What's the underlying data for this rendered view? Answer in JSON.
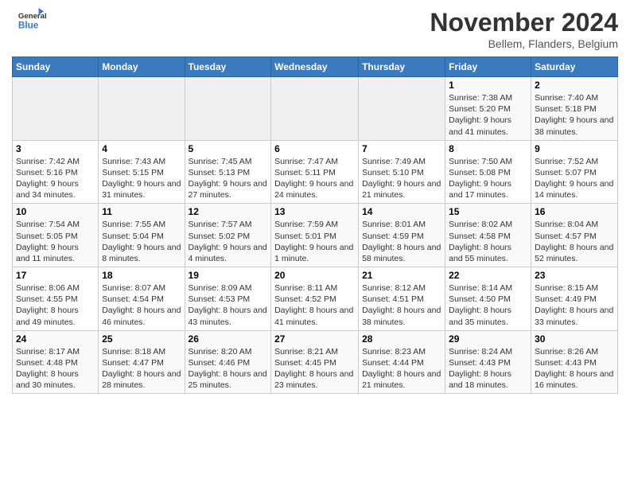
{
  "header": {
    "logo_line1": "General",
    "logo_line2": "Blue",
    "month": "November 2024",
    "location": "Bellem, Flanders, Belgium"
  },
  "weekdays": [
    "Sunday",
    "Monday",
    "Tuesday",
    "Wednesday",
    "Thursday",
    "Friday",
    "Saturday"
  ],
  "weeks": [
    [
      {
        "day": "",
        "info": ""
      },
      {
        "day": "",
        "info": ""
      },
      {
        "day": "",
        "info": ""
      },
      {
        "day": "",
        "info": ""
      },
      {
        "day": "",
        "info": ""
      },
      {
        "day": "1",
        "info": "Sunrise: 7:38 AM\nSunset: 5:20 PM\nDaylight: 9 hours and 41 minutes."
      },
      {
        "day": "2",
        "info": "Sunrise: 7:40 AM\nSunset: 5:18 PM\nDaylight: 9 hours and 38 minutes."
      }
    ],
    [
      {
        "day": "3",
        "info": "Sunrise: 7:42 AM\nSunset: 5:16 PM\nDaylight: 9 hours and 34 minutes."
      },
      {
        "day": "4",
        "info": "Sunrise: 7:43 AM\nSunset: 5:15 PM\nDaylight: 9 hours and 31 minutes."
      },
      {
        "day": "5",
        "info": "Sunrise: 7:45 AM\nSunset: 5:13 PM\nDaylight: 9 hours and 27 minutes."
      },
      {
        "day": "6",
        "info": "Sunrise: 7:47 AM\nSunset: 5:11 PM\nDaylight: 9 hours and 24 minutes."
      },
      {
        "day": "7",
        "info": "Sunrise: 7:49 AM\nSunset: 5:10 PM\nDaylight: 9 hours and 21 minutes."
      },
      {
        "day": "8",
        "info": "Sunrise: 7:50 AM\nSunset: 5:08 PM\nDaylight: 9 hours and 17 minutes."
      },
      {
        "day": "9",
        "info": "Sunrise: 7:52 AM\nSunset: 5:07 PM\nDaylight: 9 hours and 14 minutes."
      }
    ],
    [
      {
        "day": "10",
        "info": "Sunrise: 7:54 AM\nSunset: 5:05 PM\nDaylight: 9 hours and 11 minutes."
      },
      {
        "day": "11",
        "info": "Sunrise: 7:55 AM\nSunset: 5:04 PM\nDaylight: 9 hours and 8 minutes."
      },
      {
        "day": "12",
        "info": "Sunrise: 7:57 AM\nSunset: 5:02 PM\nDaylight: 9 hours and 4 minutes."
      },
      {
        "day": "13",
        "info": "Sunrise: 7:59 AM\nSunset: 5:01 PM\nDaylight: 9 hours and 1 minute."
      },
      {
        "day": "14",
        "info": "Sunrise: 8:01 AM\nSunset: 4:59 PM\nDaylight: 8 hours and 58 minutes."
      },
      {
        "day": "15",
        "info": "Sunrise: 8:02 AM\nSunset: 4:58 PM\nDaylight: 8 hours and 55 minutes."
      },
      {
        "day": "16",
        "info": "Sunrise: 8:04 AM\nSunset: 4:57 PM\nDaylight: 8 hours and 52 minutes."
      }
    ],
    [
      {
        "day": "17",
        "info": "Sunrise: 8:06 AM\nSunset: 4:55 PM\nDaylight: 8 hours and 49 minutes."
      },
      {
        "day": "18",
        "info": "Sunrise: 8:07 AM\nSunset: 4:54 PM\nDaylight: 8 hours and 46 minutes."
      },
      {
        "day": "19",
        "info": "Sunrise: 8:09 AM\nSunset: 4:53 PM\nDaylight: 8 hours and 43 minutes."
      },
      {
        "day": "20",
        "info": "Sunrise: 8:11 AM\nSunset: 4:52 PM\nDaylight: 8 hours and 41 minutes."
      },
      {
        "day": "21",
        "info": "Sunrise: 8:12 AM\nSunset: 4:51 PM\nDaylight: 8 hours and 38 minutes."
      },
      {
        "day": "22",
        "info": "Sunrise: 8:14 AM\nSunset: 4:50 PM\nDaylight: 8 hours and 35 minutes."
      },
      {
        "day": "23",
        "info": "Sunrise: 8:15 AM\nSunset: 4:49 PM\nDaylight: 8 hours and 33 minutes."
      }
    ],
    [
      {
        "day": "24",
        "info": "Sunrise: 8:17 AM\nSunset: 4:48 PM\nDaylight: 8 hours and 30 minutes."
      },
      {
        "day": "25",
        "info": "Sunrise: 8:18 AM\nSunset: 4:47 PM\nDaylight: 8 hours and 28 minutes."
      },
      {
        "day": "26",
        "info": "Sunrise: 8:20 AM\nSunset: 4:46 PM\nDaylight: 8 hours and 25 minutes."
      },
      {
        "day": "27",
        "info": "Sunrise: 8:21 AM\nSunset: 4:45 PM\nDaylight: 8 hours and 23 minutes."
      },
      {
        "day": "28",
        "info": "Sunrise: 8:23 AM\nSunset: 4:44 PM\nDaylight: 8 hours and 21 minutes."
      },
      {
        "day": "29",
        "info": "Sunrise: 8:24 AM\nSunset: 4:43 PM\nDaylight: 8 hours and 18 minutes."
      },
      {
        "day": "30",
        "info": "Sunrise: 8:26 AM\nSunset: 4:43 PM\nDaylight: 8 hours and 16 minutes."
      }
    ]
  ]
}
